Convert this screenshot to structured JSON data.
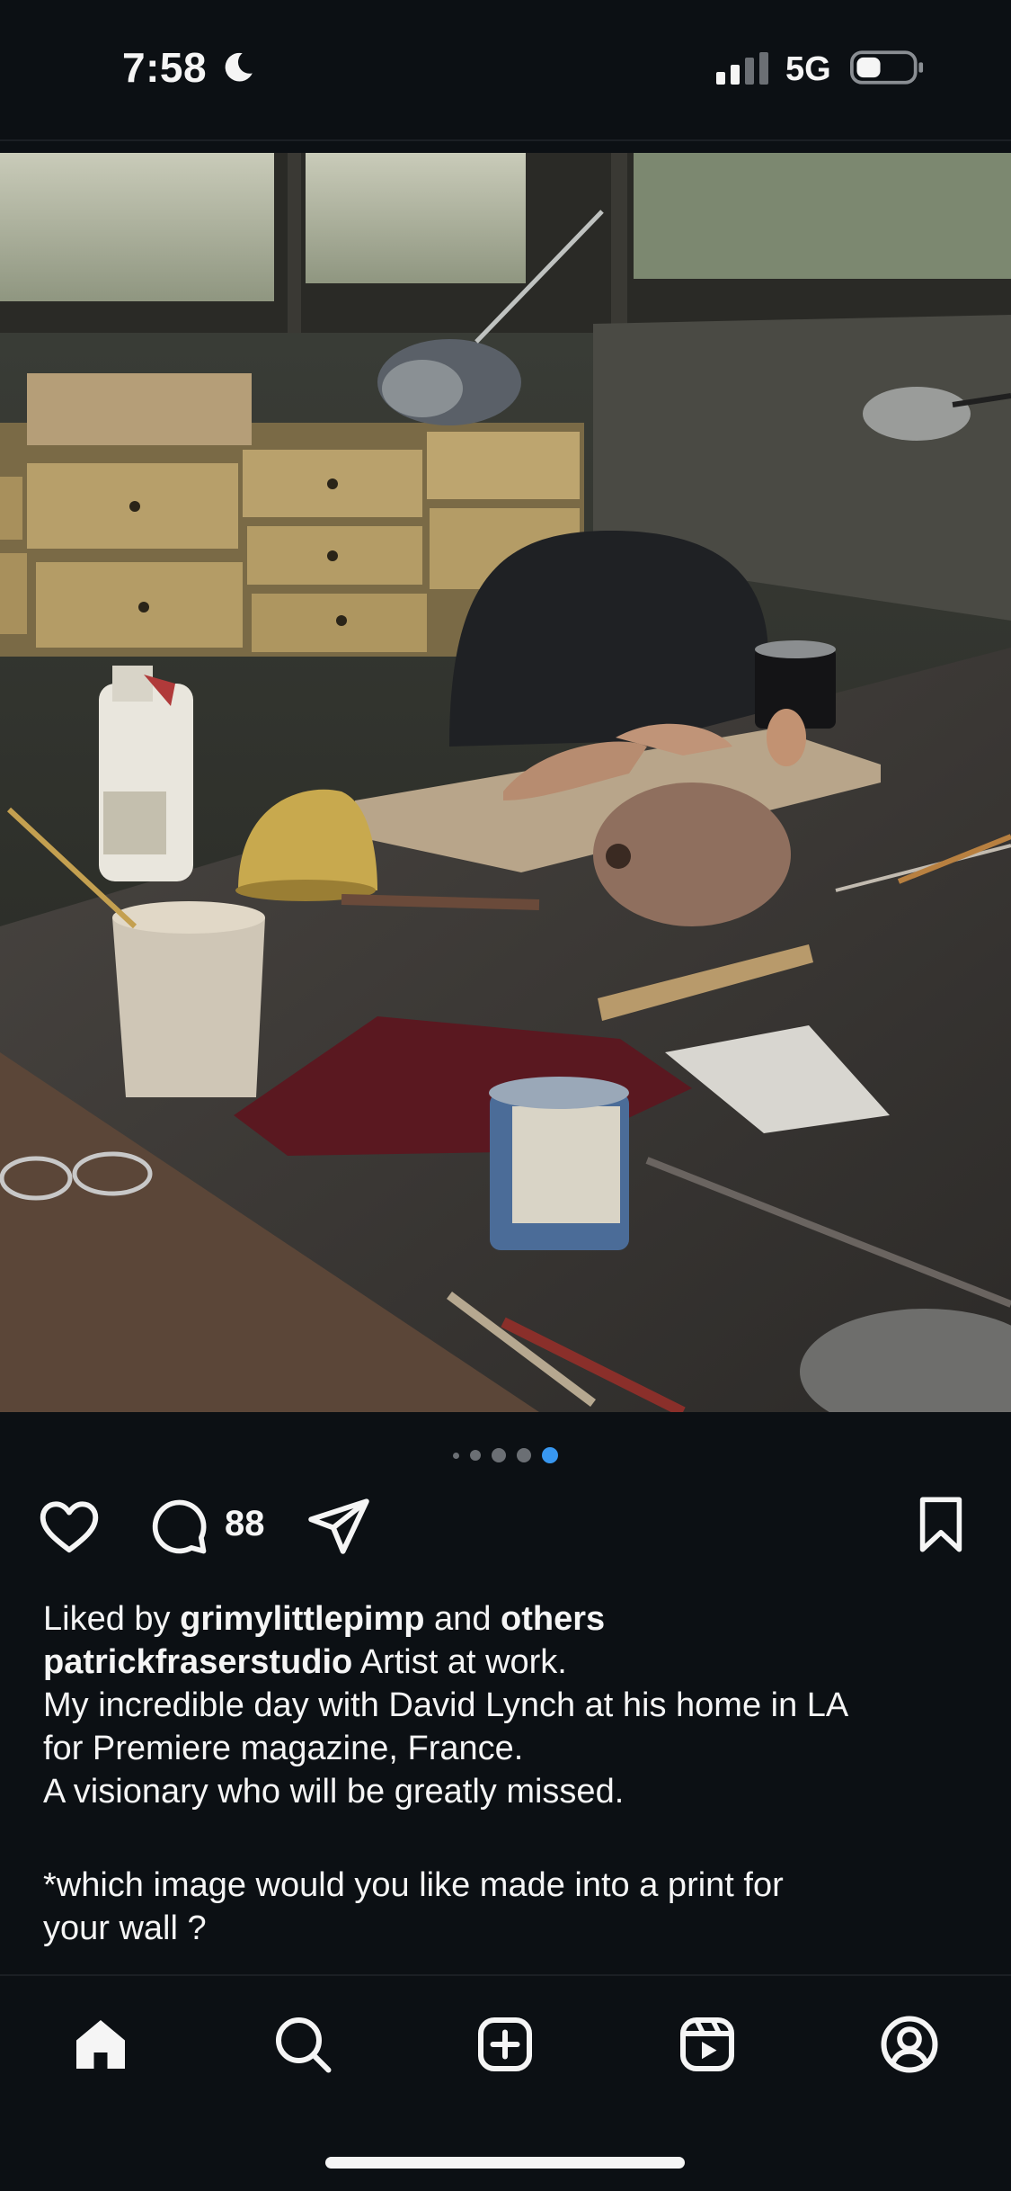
{
  "status_bar": {
    "time": "7:58",
    "network": "5G",
    "icons": [
      "moon-icon",
      "signal-icon",
      "battery-icon"
    ]
  },
  "post": {
    "image_description_icon": "photo",
    "carousel": {
      "count": 5,
      "active_index": 4
    },
    "comment_count": "88",
    "liked_by": {
      "prefix": "Liked by",
      "user": "grimylittlepimp",
      "conjunction": "and",
      "others": "others"
    },
    "caption": {
      "username": "patrickfraserstudio",
      "first_line": "Artist at work.",
      "line2": "My incredible day with David Lynch at his home in LA",
      "line3": "for Premiere magazine, France.",
      "line4": "A visionary who will be greatly missed.",
      "line5": "*which image would you like made into a print for",
      "line6": "your wall ?"
    }
  },
  "tab_bar": {
    "tabs": [
      "home-icon",
      "search-icon",
      "create-icon",
      "reels-icon",
      "profile-icon"
    ]
  },
  "colors": {
    "background": "#0c1014",
    "text": "#f5f5f5",
    "accent_dot": "#3897f0"
  }
}
